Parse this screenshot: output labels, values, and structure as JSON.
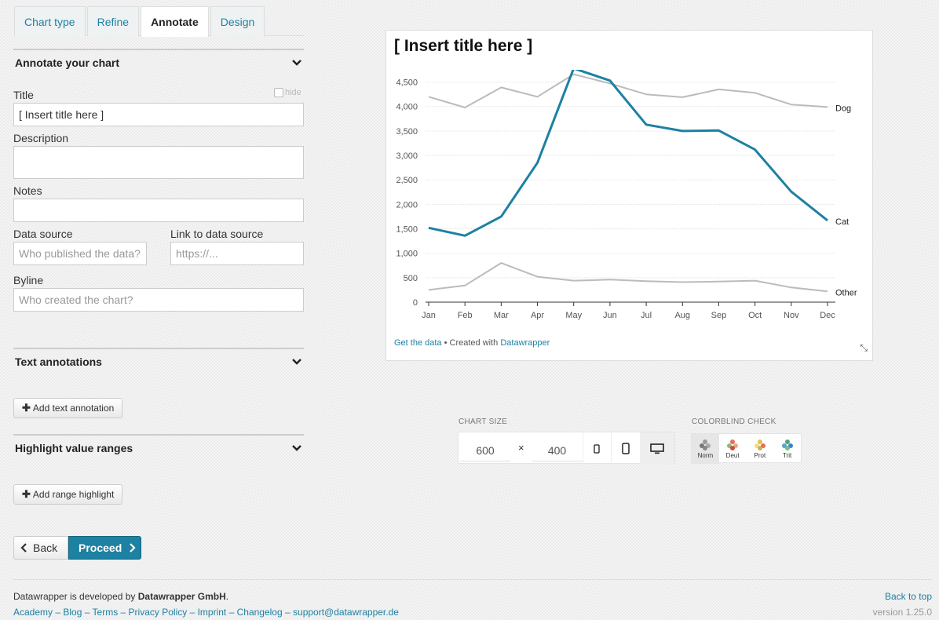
{
  "tabs": [
    "Chart type",
    "Refine",
    "Annotate",
    "Design"
  ],
  "annotate": {
    "heading": "Annotate your chart",
    "title_label": "Title",
    "hide_label": "hide",
    "title_value": "[ Insert title here ]",
    "description_label": "Description",
    "notes_label": "Notes",
    "source_label": "Data source",
    "source_placeholder": "Who published the data?",
    "link_label": "Link to data source",
    "link_placeholder": "https://...",
    "byline_label": "Byline",
    "byline_placeholder": "Who created the chart?"
  },
  "text_annotations": {
    "heading": "Text annotations",
    "add_label": "Add text annotation"
  },
  "highlight": {
    "heading": "Highlight value ranges",
    "add_label": "Add range highlight"
  },
  "nav": {
    "back": "Back",
    "proceed": "Proceed"
  },
  "chart": {
    "title": "[ Insert title here ]",
    "footer": {
      "get_data": "Get the data",
      "sep": " • Created with ",
      "tool": "Datawrapper"
    }
  },
  "chart_data": {
    "type": "line",
    "title": "[ Insert title here ]",
    "x": [
      "Jan",
      "Feb",
      "Mar",
      "Apr",
      "May",
      "Jun",
      "Jul",
      "Aug",
      "Sep",
      "Oct",
      "Nov",
      "Dec"
    ],
    "yticks": [
      "0",
      "500",
      "1,000",
      "1,500",
      "2,000",
      "2,500",
      "3,000",
      "3,500",
      "4,000",
      "4,500"
    ],
    "ylim": [
      0,
      4750
    ],
    "series": [
      {
        "name": "Dog",
        "color": "#bbbbbb",
        "values": [
          4200,
          3980,
          4390,
          4200,
          4660,
          4470,
          4250,
          4190,
          4350,
          4280,
          4040,
          3990
        ]
      },
      {
        "name": "Cat",
        "color": "#1d81a2",
        "values": [
          1520,
          1360,
          1750,
          2850,
          4780,
          4530,
          3630,
          3500,
          3510,
          3120,
          2260,
          1670
        ]
      },
      {
        "name": "Other",
        "color": "#bbbbbb",
        "values": [
          250,
          340,
          800,
          520,
          440,
          460,
          430,
          410,
          420,
          440,
          300,
          220
        ]
      }
    ],
    "grid": true,
    "legend": "direct labels at right"
  },
  "chart_size": {
    "caption": "CHART SIZE",
    "width": "600",
    "x": "×",
    "height": "400"
  },
  "colorblind": {
    "caption": "COLORBLIND CHECK",
    "modes": [
      "Norm",
      "Deut",
      "Prot",
      "Trit"
    ]
  },
  "footer": {
    "dev_prefix": "Datawrapper is developed by ",
    "dev_company": "Datawrapper GmbH",
    "dev_suffix": ".",
    "links": [
      "Academy",
      "Blog",
      "Terms",
      "Privacy Policy",
      "Imprint",
      "Changelog",
      "support@datawrapper.de"
    ],
    "back_to_top": "Back to top",
    "version_label": "version",
    "version": "1.25.0"
  }
}
